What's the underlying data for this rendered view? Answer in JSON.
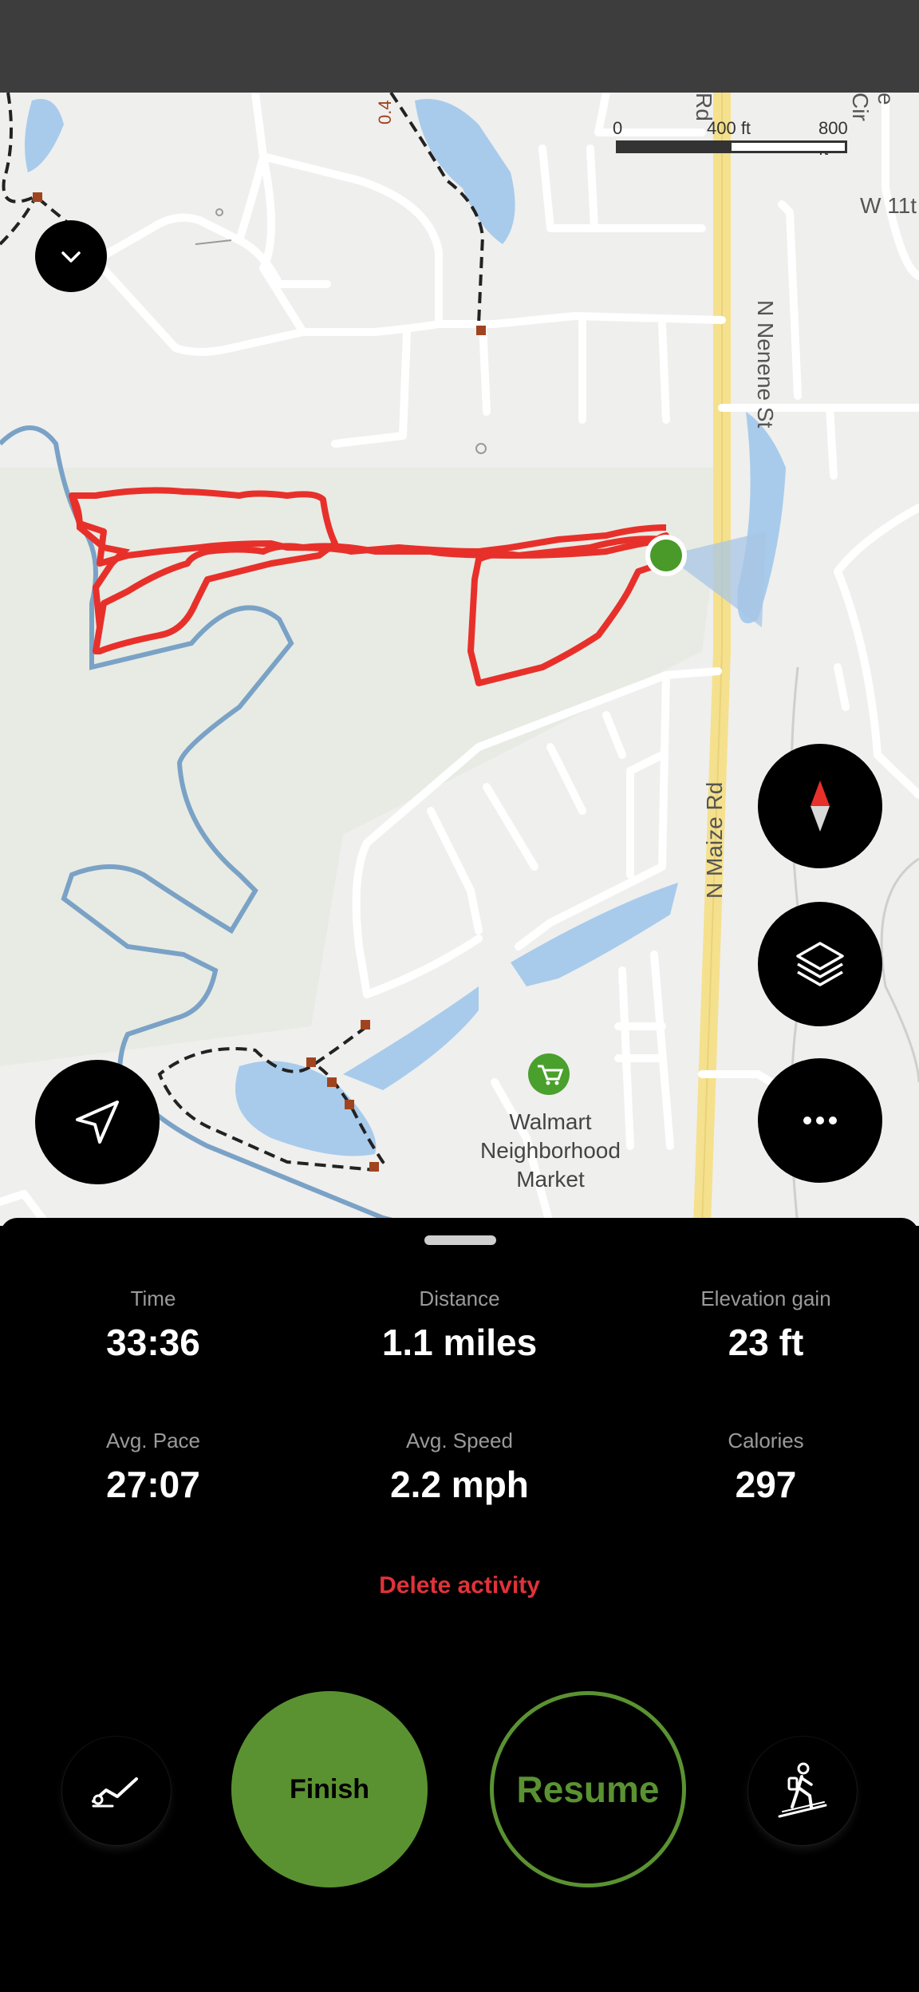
{
  "map": {
    "scale": {
      "zero": "0",
      "mid": "400 ft",
      "max": "800 ft"
    },
    "streets": {
      "maize": "N Maize Rd",
      "nene": "N Nenene St",
      "w11": "W 11t",
      "rd_top": "Rd",
      "cir": "e Cir",
      "partial": "0.4"
    },
    "poi": {
      "name_line1": "Walmart",
      "name_line2": "Neighborhood",
      "name_line3": "Market",
      "icon": "shopping-cart-icon"
    },
    "buttons": {
      "collapse": "chevron-down-icon",
      "compass": "compass-icon",
      "layers": "layers-icon",
      "more": "more-horizontal-icon",
      "locate": "navigation-arrow-icon"
    },
    "colors": {
      "route": "#e8302b",
      "water": "#a8cbeb",
      "road_major": "#f5e18d",
      "current_location": "#4a9a2a"
    }
  },
  "stats": [
    {
      "label": "Time",
      "value": "33:36"
    },
    {
      "label": "Distance",
      "value": "1.1 miles"
    },
    {
      "label": "Elevation gain",
      "value": "23 ft"
    },
    {
      "label": "Avg. Pace",
      "value": "27:07"
    },
    {
      "label": "Avg. Speed",
      "value": "2.2 mph"
    },
    {
      "label": "Calories",
      "value": "297"
    }
  ],
  "actions": {
    "delete": "Delete activity",
    "finish": "Finish",
    "resume": "Resume",
    "left_icon": "chart-line-icon",
    "right_icon": "hiking-icon"
  }
}
